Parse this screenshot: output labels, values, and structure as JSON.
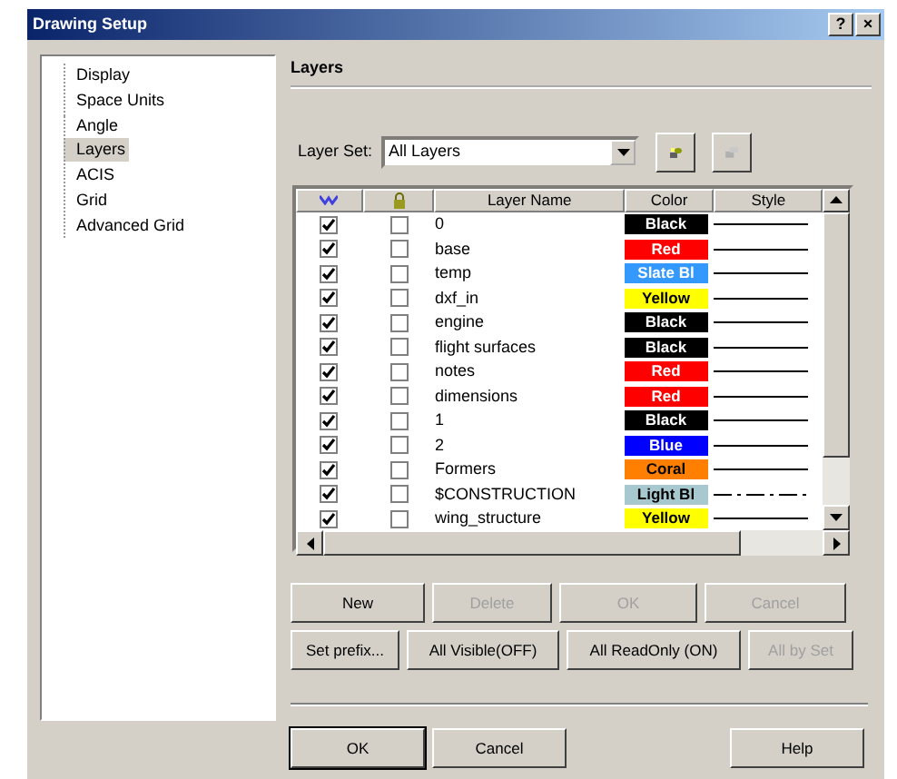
{
  "window": {
    "title": "Drawing Setup",
    "title_buttons": [
      "?",
      "×"
    ]
  },
  "sidebar": {
    "items": [
      {
        "label": "Display",
        "selected": false
      },
      {
        "label": "Space Units",
        "selected": false
      },
      {
        "label": "Angle",
        "selected": false
      },
      {
        "label": "Layers",
        "selected": true
      },
      {
        "label": "ACIS",
        "selected": false
      },
      {
        "label": "Grid",
        "selected": false
      },
      {
        "label": "Advanced Grid",
        "selected": false
      }
    ]
  },
  "section_title": "Layers",
  "layer_set": {
    "label": "Layer Set:",
    "value": "All Layers"
  },
  "table": {
    "columns": [
      "Layer Name",
      "Color",
      "Style"
    ],
    "rows": [
      {
        "visible": true,
        "read_only": false,
        "name": "0",
        "color_name": "Black",
        "color": "#000000",
        "kind": "solid"
      },
      {
        "visible": true,
        "read_only": false,
        "name": "base",
        "color_name": "Red",
        "color": "#ff0000",
        "kind": "solid"
      },
      {
        "visible": true,
        "read_only": false,
        "name": "temp",
        "color_name": "Slate Bl",
        "color": "#3399ff",
        "kind": "solid"
      },
      {
        "visible": true,
        "read_only": false,
        "name": "dxf_in",
        "color_name": "Yellow",
        "color": "#ffff00",
        "kind": "solid"
      },
      {
        "visible": true,
        "read_only": false,
        "name": "engine",
        "color_name": "Black",
        "color": "#000000",
        "kind": "solid"
      },
      {
        "visible": true,
        "read_only": false,
        "name": "flight surfaces",
        "color_name": "Black",
        "color": "#000000",
        "kind": "solid"
      },
      {
        "visible": true,
        "read_only": false,
        "name": "notes",
        "color_name": "Red",
        "color": "#ff0000",
        "kind": "solid"
      },
      {
        "visible": true,
        "read_only": false,
        "name": "dimensions",
        "color_name": "Red",
        "color": "#ff0000",
        "kind": "solid"
      },
      {
        "visible": true,
        "read_only": false,
        "name": "1",
        "color_name": "Black",
        "color": "#000000",
        "kind": "solid"
      },
      {
        "visible": true,
        "read_only": false,
        "name": "2",
        "color_name": "Blue",
        "color": "#0000ff",
        "kind": "solid"
      },
      {
        "visible": true,
        "read_only": false,
        "name": "Formers",
        "color_name": "Coral",
        "color": "#ff8000",
        "kind": "solid"
      },
      {
        "visible": true,
        "read_only": false,
        "name": "$CONSTRUCTION",
        "color_name": "Light Bl",
        "color": "#a8c8d0",
        "kind": "dashdot"
      },
      {
        "visible": true,
        "read_only": false,
        "name": "wing_structure",
        "color_name": "Yellow",
        "color": "#ffff00",
        "kind": "solid"
      }
    ]
  },
  "edit_buttons": [
    {
      "label": "New",
      "disabled": false
    },
    {
      "label": "Delete",
      "disabled": true
    },
    {
      "label": "OK",
      "disabled": true
    },
    {
      "label": "Cancel",
      "disabled": true
    }
  ],
  "set_buttons": [
    {
      "label": "Set prefix...",
      "disabled": false
    },
    {
      "label": "All Visible(OFF)",
      "disabled": false
    },
    {
      "label": "All ReadOnly (ON)",
      "disabled": false
    },
    {
      "label": "All by Set",
      "disabled": true
    }
  ],
  "dialog_buttons": [
    {
      "label": "OK",
      "default": true
    },
    {
      "label": "Cancel",
      "default": false
    },
    {
      "label": "Help",
      "default": false
    }
  ]
}
